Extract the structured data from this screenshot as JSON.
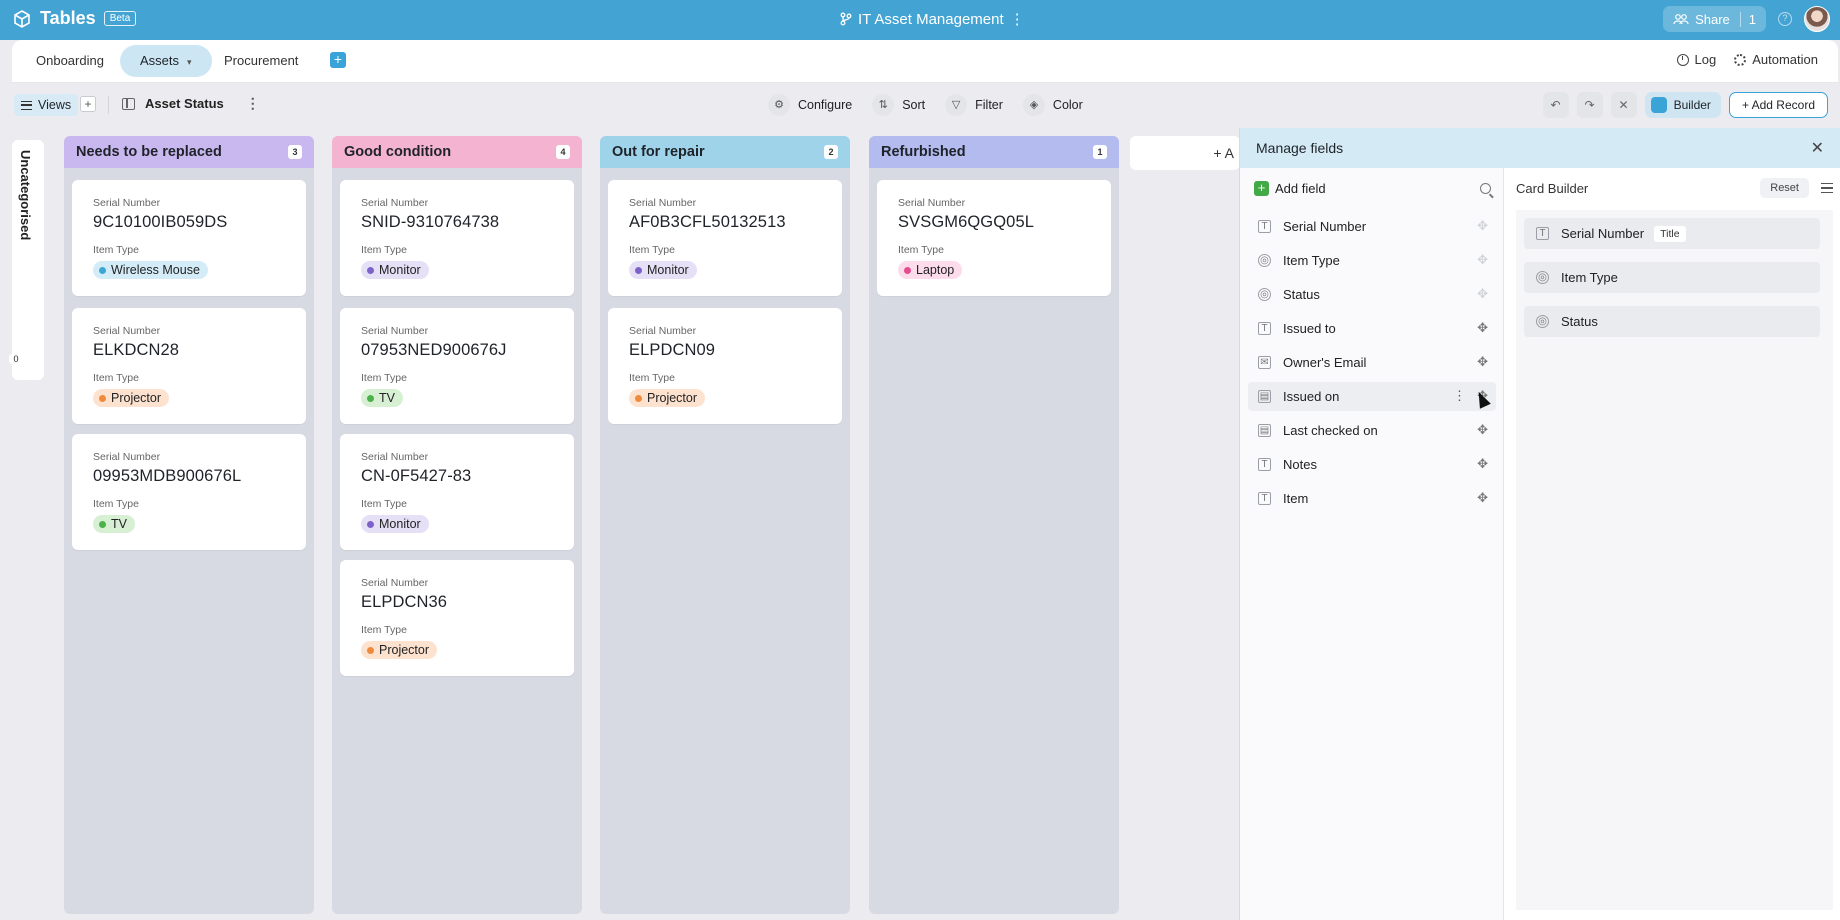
{
  "app": {
    "name": "Tables",
    "badge": "Beta",
    "doc_title": "IT Asset Management",
    "doc_menu": "⋮"
  },
  "share": {
    "label": "Share",
    "count": "1",
    "help": "?"
  },
  "tabs": [
    {
      "label": "Onboarding"
    },
    {
      "label": "Assets",
      "caret": "▾"
    },
    {
      "label": "Procurement"
    }
  ],
  "tab_add": "+",
  "tabs_right": {
    "log": "Log",
    "automation": "Automation"
  },
  "toolbar": {
    "views": "Views",
    "views_add": "+",
    "view_name": "Asset Status",
    "kebab": "⋮",
    "configure": "Configure",
    "sort": "Sort",
    "filter": "Filter",
    "color": "Color",
    "builder": "Builder",
    "add_record": "+ Add Record"
  },
  "uncategorised": {
    "label": "Uncategorised",
    "count": "0"
  },
  "labels": {
    "serial": "Serial Number",
    "item_type": "Item Type"
  },
  "columns": [
    {
      "title": "Needs to be replaced",
      "count": "3",
      "color": "#c9b8f0",
      "cards": [
        {
          "serial": "9C10100IB059DS",
          "type": "Wireless Mouse",
          "pill_bg": "#d4ecf7",
          "dot": "#3ba7d6"
        },
        {
          "serial": "ELKDCN28",
          "type": "Projector",
          "pill_bg": "#fde3cf",
          "dot": "#ef8a3c"
        },
        {
          "serial": "09953MDB900676L",
          "type": "TV",
          "pill_bg": "#d7f0d4",
          "dot": "#4bb14a"
        }
      ]
    },
    {
      "title": "Good condition",
      "count": "4",
      "color": "#f3b3d1",
      "cards": [
        {
          "serial": "SNID-9310764738",
          "type": "Monitor",
          "pill_bg": "#e6e0f7",
          "dot": "#7c62c9"
        },
        {
          "serial": "07953NED900676J",
          "type": "TV",
          "pill_bg": "#d7f0d4",
          "dot": "#4bb14a"
        },
        {
          "serial": "CN-0F5427-83",
          "type": "Monitor",
          "pill_bg": "#e6e0f7",
          "dot": "#7c62c9"
        },
        {
          "serial": "ELPDCN36",
          "type": "Projector",
          "pill_bg": "#fde3cf",
          "dot": "#ef8a3c"
        }
      ]
    },
    {
      "title": "Out for repair",
      "count": "2",
      "color": "#9ed3ea",
      "cards": [
        {
          "serial": "AF0B3CFL50132513",
          "type": "Monitor",
          "pill_bg": "#e6e0f7",
          "dot": "#7c62c9"
        },
        {
          "serial": "ELPDCN09",
          "type": "Projector",
          "pill_bg": "#fde3cf",
          "dot": "#ef8a3c"
        }
      ]
    },
    {
      "title": "Refurbished",
      "count": "1",
      "color": "#b3bbef",
      "cards": [
        {
          "serial": "SVSGM6QGQ05L",
          "type": "Laptop",
          "pill_bg": "#fcdcea",
          "dot": "#e44c8f"
        }
      ]
    }
  ],
  "add_column": "+ A",
  "manage_fields": {
    "title": "Manage fields",
    "close": "✕",
    "add_field": "Add field",
    "fields": [
      {
        "label": "Serial Number",
        "icon": "text",
        "movable": false
      },
      {
        "label": "Item Type",
        "icon": "select",
        "movable": false
      },
      {
        "label": "Status",
        "icon": "select",
        "movable": false
      },
      {
        "label": "Issued to",
        "icon": "text",
        "movable": true
      },
      {
        "label": "Owner's Email",
        "icon": "email",
        "movable": true
      },
      {
        "label": "Issued on",
        "icon": "date",
        "movable": true
      },
      {
        "label": "Last checked on",
        "icon": "date",
        "movable": true
      },
      {
        "label": "Notes",
        "icon": "text",
        "movable": true
      },
      {
        "label": "Item",
        "icon": "text",
        "movable": true
      }
    ],
    "card_builder": {
      "title": "Card Builder",
      "reset": "Reset",
      "title_tag": "Title",
      "fields": [
        {
          "label": "Serial Number",
          "icon": "text"
        },
        {
          "label": "Item Type",
          "icon": "select"
        },
        {
          "label": "Status",
          "icon": "select"
        }
      ]
    }
  }
}
